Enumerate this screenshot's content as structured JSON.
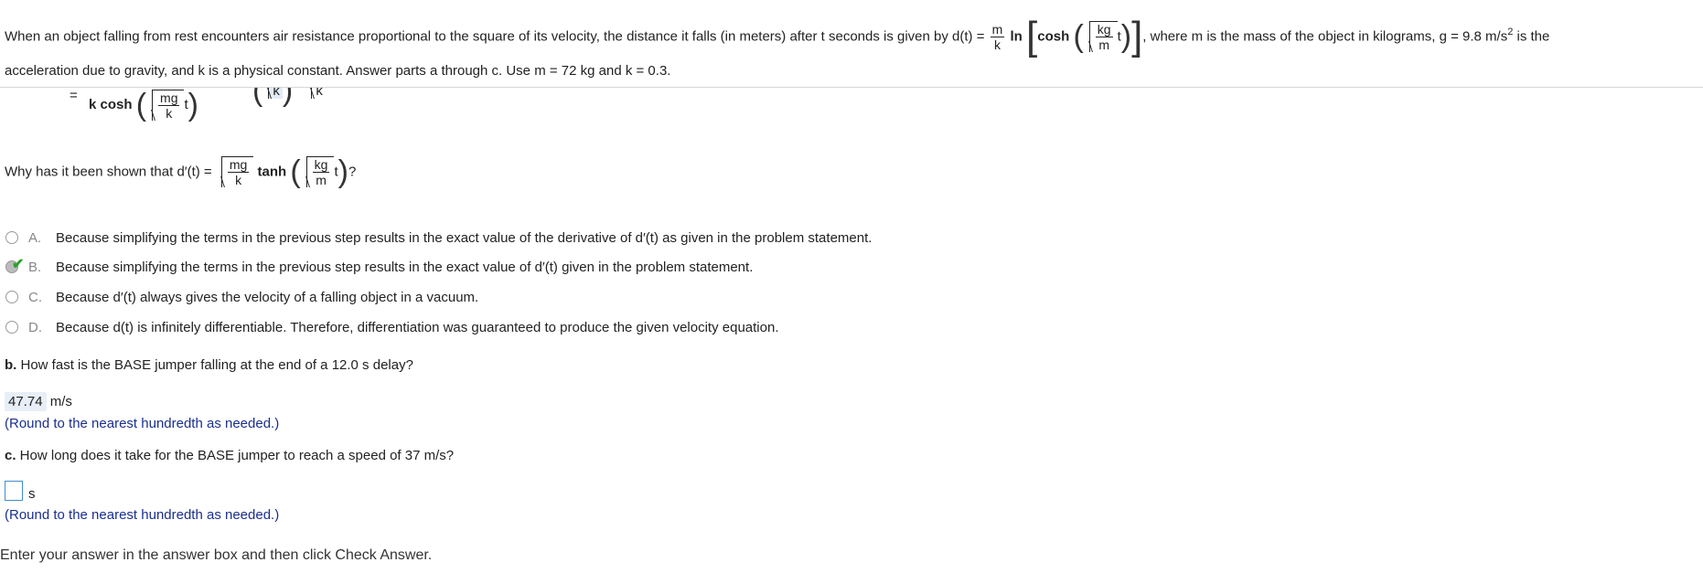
{
  "header": {
    "intro": "When an object falling from rest encounters air resistance proportional to the square of its velocity, the distance it falls (in meters) after t seconds is given by d(t) =",
    "frac_m": "m",
    "frac_k": "k",
    "ln": "ln",
    "cosh": "cosh",
    "kg": "kg",
    "m_den": "m",
    "t": "t",
    "after_formula": ", where m is the mass of the object in kilograms, g = 9.8 m/s",
    "sup": "2",
    "is_the": " is the",
    "line2": "acceleration due to gravity, and k is a physical constant. Answer parts a through c. Use m = 72 kg and k = 0.3."
  },
  "partial": {
    "equals": "=",
    "k_cosh": "k cosh",
    "mg": "mg",
    "k": "k",
    "t": "t",
    "top_k1": "k",
    "top_k2": "k"
  },
  "question": {
    "prefix": "Why has it been shown that d′(t) =",
    "mg": "mg",
    "k": "k",
    "tanh": "tanh",
    "kg": "kg",
    "m": "m",
    "t": "t",
    "suffix": "?"
  },
  "options": [
    {
      "letter": "A.",
      "text": "Because simplifying the terms in the previous step results in the exact value of the derivative of d′(t) as given in the problem statement.",
      "selected": false
    },
    {
      "letter": "B.",
      "text": "Because simplifying the terms in the previous step results in the exact value of d′(t) given in the problem statement.",
      "selected": true
    },
    {
      "letter": "C.",
      "text": "Because d′(t) always gives the velocity of a falling object in a vacuum.",
      "selected": false
    },
    {
      "letter": "D.",
      "text": "Because d(t) is infinitely differentiable. Therefore, differentiation was guaranteed to produce the given velocity equation.",
      "selected": false
    }
  ],
  "part_b": {
    "label": "b.",
    "question": " How fast is the BASE jumper falling at the end of a 12.0 s delay?",
    "answer": "47.74",
    "unit": "m/s",
    "hint": "(Round to the nearest hundredth as needed.)"
  },
  "part_c": {
    "label": "c.",
    "question": " How long does it take for the BASE jumper to reach a speed of 37 m/s?",
    "answer": "",
    "unit": "s",
    "hint": "(Round to the nearest hundredth as needed.)"
  },
  "footer": "Enter your answer in the answer box and then click Check Answer."
}
